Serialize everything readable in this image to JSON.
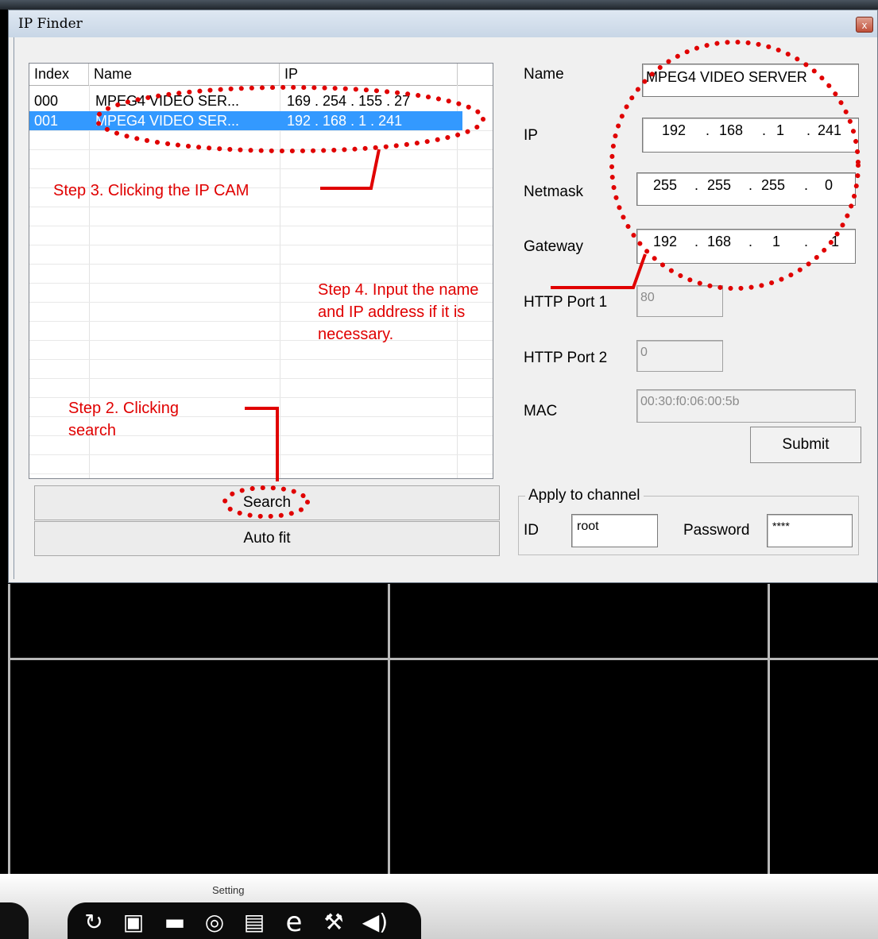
{
  "dialog": {
    "title": "IP Finder",
    "close_label": "x"
  },
  "list": {
    "columns": [
      "Index",
      "Name",
      "IP"
    ],
    "rows": [
      {
        "index": "000",
        "name": "MPEG4 VIDEO SER...",
        "ip": "169 . 254 . 155 . 27"
      },
      {
        "index": "001",
        "name": "MPEG4 VIDEO SER...",
        "ip": "192 . 168 . 1 . 241"
      }
    ],
    "selected_row": 1
  },
  "buttons": {
    "search": "Search",
    "auto_fit": "Auto fit",
    "submit": "Submit"
  },
  "form": {
    "name_label": "Name",
    "name_value": "MPEG4 VIDEO SERVER",
    "ip_label": "IP",
    "ip": [
      "192",
      "168",
      "1",
      "241"
    ],
    "netmask_label": "Netmask",
    "netmask": [
      "255",
      "255",
      "255",
      "0"
    ],
    "gateway_label": "Gateway",
    "gateway": [
      "192",
      "168",
      "1",
      "1"
    ],
    "http_port1_label": "HTTP Port 1",
    "http_port1": "80",
    "http_port2_label": "HTTP Port 2",
    "http_port2": "0",
    "mac_label": "MAC",
    "mac": "00:30:f0:06:00:5b",
    "dot": "."
  },
  "apply": {
    "legend": "Apply to channel",
    "id_label": "ID",
    "id_value": "root",
    "password_label": "Password",
    "password_value": "****"
  },
  "annotations": {
    "step2_line1": "Step 2. Clicking",
    "step2_line2": "search",
    "step3": "Step 3. Clicking the IP CAM",
    "step4_line1": "Step 4. Input the name",
    "step4_line2": "and IP address if it is",
    "step4_line3": "necessary."
  },
  "colors": {
    "annotation": "#e00000",
    "selection": "#3399ff"
  },
  "taskbar": {
    "setting_label": "Setting",
    "icons": [
      "refresh-icon",
      "lock-icon",
      "folder-icon",
      "globe-icon",
      "document-icon",
      "ie-icon",
      "tools-icon",
      "speaker-icon"
    ]
  }
}
